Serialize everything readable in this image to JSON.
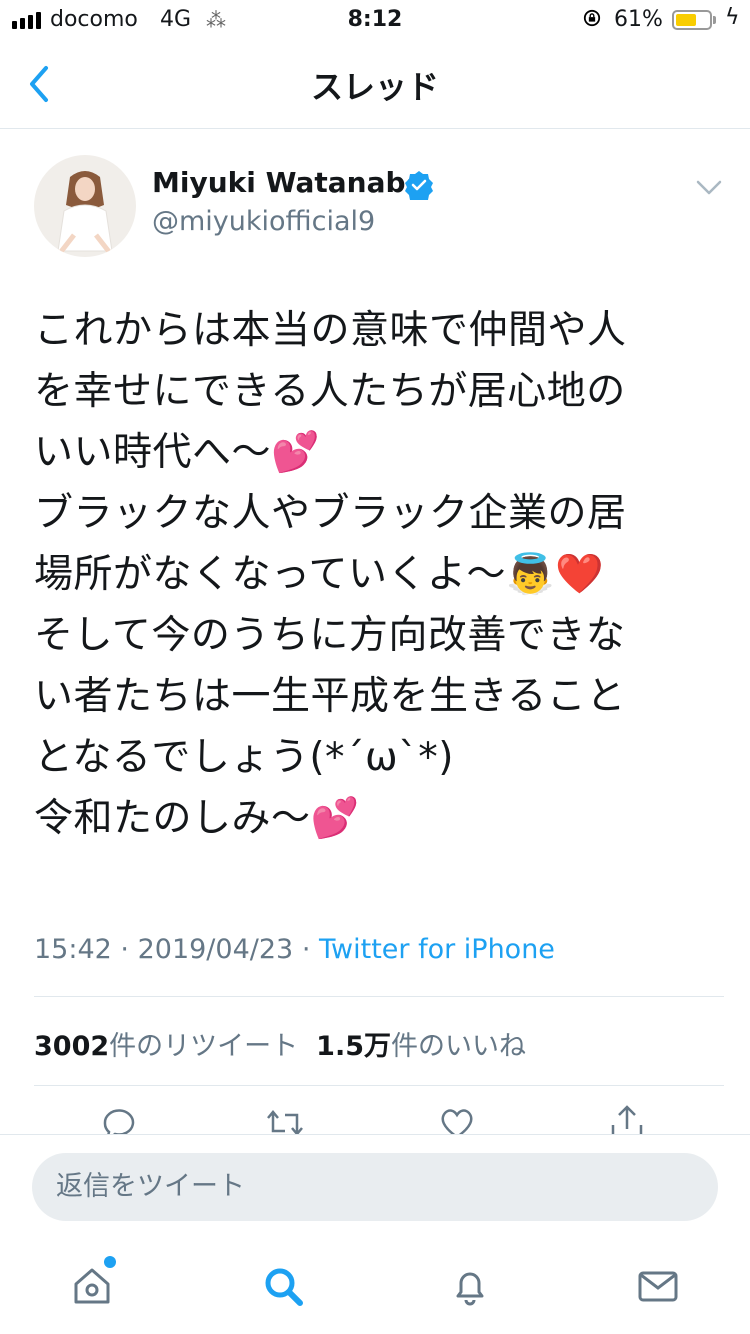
{
  "status_bar": {
    "carrier": "docomo",
    "network": "4G",
    "time": "8:12",
    "battery_percent": "61%",
    "battery_level": 0.61
  },
  "nav": {
    "title": "スレッド",
    "back_icon": "chevron-left-icon"
  },
  "tweet": {
    "author_name": "Miyuki Watanabe",
    "handle": "@miyukiofficial9",
    "verified": true,
    "text": "これからは本当の意味で仲間や人\nを幸せにできる人たちが居心地の\nいい時代へ〜💕\nブラックな人やブラック企業の居\n場所がなくなっていくよ〜👼❤️\nそして今のうちに方向改善できな\nい者たちは一生平成を生きること\nとなるでしょう(*´ω`*)\n令和たのしみ〜💕",
    "time": "15:42",
    "date": "2019/04/23",
    "separator": "·",
    "source": "Twitter for iPhone",
    "retweet_count": "3002",
    "retweet_label": "件のリツイート",
    "like_count": "1.5万",
    "like_label": "件のいいね"
  },
  "reply": {
    "placeholder": "返信をツイート"
  },
  "colors": {
    "accent": "#1da1f2",
    "muted": "#657786",
    "battery": "#f9cd00"
  },
  "tab_icons": [
    "home-icon",
    "search-icon",
    "notifications-icon",
    "messages-icon"
  ]
}
